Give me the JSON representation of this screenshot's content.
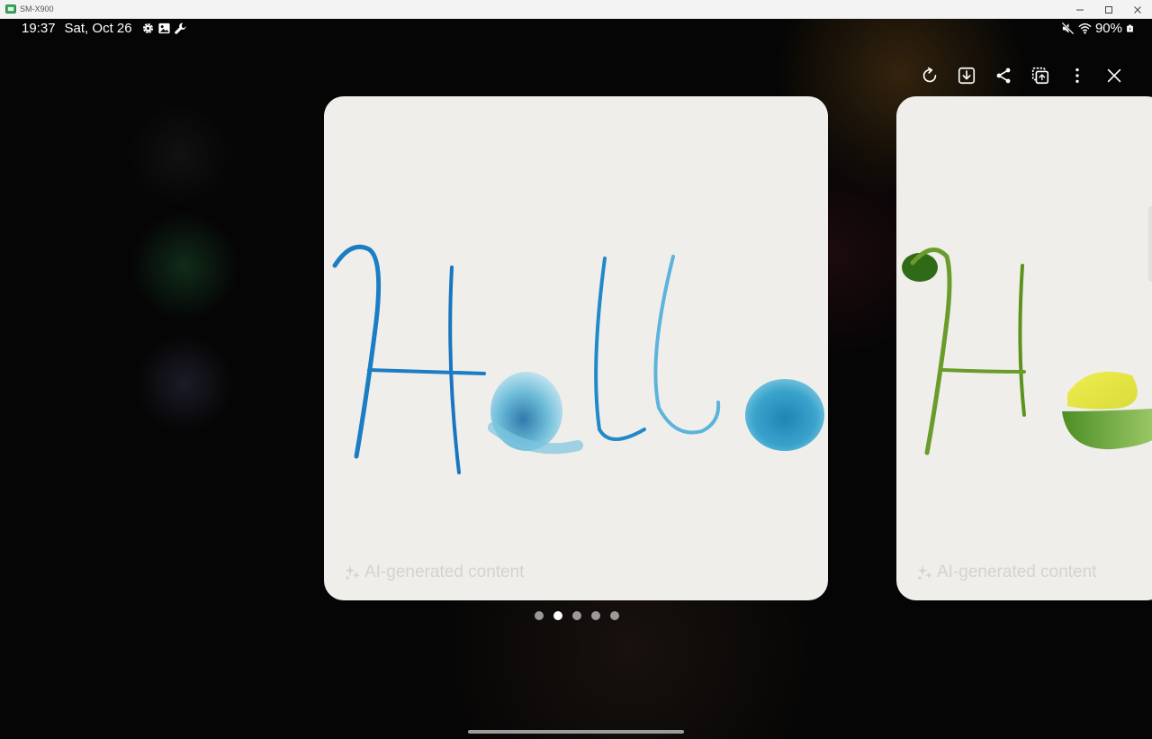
{
  "window": {
    "title": "SM-X900",
    "controls": [
      "minimize",
      "maximize",
      "close"
    ]
  },
  "status_bar": {
    "time": "19:37",
    "date": "Sat, Oct 26",
    "left_icons": [
      "gear-icon",
      "image-icon",
      "wrench-icon"
    ],
    "right_icons": [
      "mute-icon",
      "wifi-icon",
      "battery-icon"
    ],
    "battery": "90%"
  },
  "toolbar": {
    "actions": [
      {
        "name": "rotate",
        "icon": "rotate-icon"
      },
      {
        "name": "save",
        "icon": "download-icon"
      },
      {
        "name": "share",
        "icon": "share-icon"
      },
      {
        "name": "copy",
        "icon": "copy-icon"
      },
      {
        "name": "more",
        "icon": "more-vertical-icon"
      },
      {
        "name": "close",
        "icon": "close-icon"
      }
    ]
  },
  "cards": {
    "main": {
      "text": "Hello",
      "ai_label": "AI-generated content",
      "colors": [
        "#1a78c2",
        "#5db3d9",
        "#2b9ac4"
      ]
    },
    "next": {
      "ai_label": "AI-generated content",
      "colors": [
        "#3d7a1f",
        "#6fae3a",
        "#e6e34a"
      ]
    }
  },
  "pager": {
    "count": 5,
    "active_index": 1
  },
  "colors": {
    "card_bg": "#efeeea",
    "dot_inactive": "#9a9a9a",
    "dot_active": "#ffffff"
  }
}
